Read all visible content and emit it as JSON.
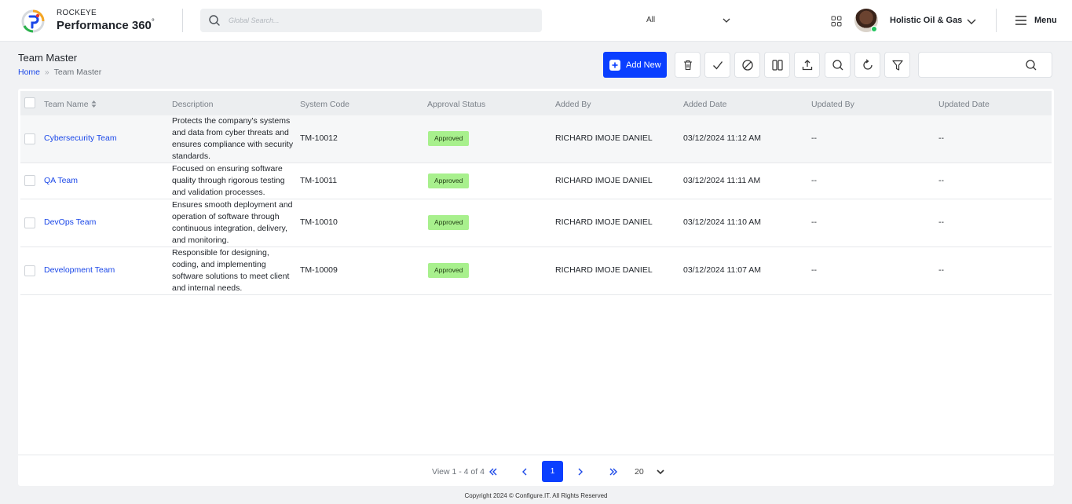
{
  "brand": {
    "top": "ROCKEYE",
    "main": "Performance 360",
    "degree": "°"
  },
  "search": {
    "placeholder": "Global Search...",
    "scope_value": "All"
  },
  "user": {
    "org_name": "Holistic Oil & Gas"
  },
  "menu": {
    "label": "Menu"
  },
  "page": {
    "title": "Team Master"
  },
  "breadcrumb": {
    "home": "Home",
    "sep": "»",
    "current": "Team Master"
  },
  "toolbar": {
    "add_label": "Add New",
    "tools": [
      "delete-icon",
      "check-icon",
      "block-icon",
      "columns-icon",
      "export-icon",
      "search-icon",
      "refresh-icon",
      "filter-icon"
    ]
  },
  "table": {
    "columns": [
      "Team Name",
      "Description",
      "System Code",
      "Approval Status",
      "Added By",
      "Added Date",
      "Updated By",
      "Updated Date"
    ],
    "rows": [
      {
        "name": "Cybersecurity Team",
        "description": "Protects the company's systems and data from cyber threats and ensures compliance with security standards.",
        "code": "TM-10012",
        "status": "Approved",
        "added_by": "RICHARD IMOJE DANIEL",
        "added_date": "03/12/2024 11:12 AM",
        "updated_by": "--",
        "updated_date": "--"
      },
      {
        "name": "QA Team",
        "description": "Focused on ensuring software quality through rigorous testing and validation processes.",
        "code": "TM-10011",
        "status": "Approved",
        "added_by": "RICHARD IMOJE DANIEL",
        "added_date": "03/12/2024 11:11 AM",
        "updated_by": "--",
        "updated_date": "--"
      },
      {
        "name": "DevOps Team",
        "description": "Ensures smooth deployment and operation of software through continuous integration, delivery, and monitoring.",
        "code": "TM-10010",
        "status": "Approved",
        "added_by": "RICHARD IMOJE DANIEL",
        "added_date": "03/12/2024 11:10 AM",
        "updated_by": "--",
        "updated_date": "--"
      },
      {
        "name": "Development Team",
        "description": "Responsible for designing, coding, and implementing software solutions to meet client and internal needs.",
        "code": "TM-10009",
        "status": "Approved",
        "added_by": "RICHARD IMOJE DANIEL",
        "added_date": "03/12/2024 11:07 AM",
        "updated_by": "--",
        "updated_date": "--"
      }
    ]
  },
  "pager": {
    "view_text": "View 1 - 4 of 4",
    "current_page": "1",
    "page_size": "20"
  },
  "footer": {
    "copyright": "Copyright 2024 © Configure.IT. All Rights Reserved"
  },
  "colors": {
    "primary": "#0a3fff",
    "link": "#1a47e8",
    "approved_badge": "#a8f08d",
    "online": "#22c55e"
  }
}
